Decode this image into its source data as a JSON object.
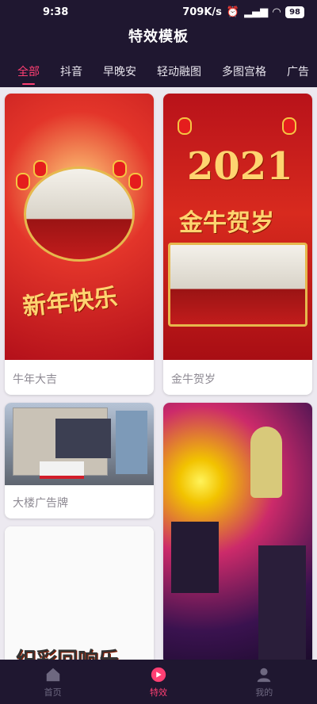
{
  "status": {
    "time": "9:38",
    "speed": "709K/s",
    "battery": "98"
  },
  "header": {
    "title": "特效模板"
  },
  "tabs": [
    {
      "label": "全部",
      "active": true
    },
    {
      "label": "抖音"
    },
    {
      "label": "早晚安"
    },
    {
      "label": "轻动融图"
    },
    {
      "label": "多图宫格"
    },
    {
      "label": "广告"
    }
  ],
  "cards": [
    {
      "label": "牛年大吉",
      "art": {
        "text": "新年快乐"
      }
    },
    {
      "label": "金牛贺岁",
      "art": {
        "year": "2021",
        "text": "金牛贺岁"
      }
    },
    {
      "label": "大楼广告牌"
    },
    {
      "label": ""
    },
    {
      "label": "",
      "art": {
        "text": "织彩回响乐"
      }
    }
  ],
  "tabbar": [
    {
      "label": "首页",
      "icon": "home-icon"
    },
    {
      "label": "特效",
      "icon": "effects-icon",
      "active": true
    },
    {
      "label": "我的",
      "icon": "profile-icon"
    }
  ],
  "colors": {
    "accent": "#ff3f73",
    "bar": "#1f1730",
    "background": "#ece9f0"
  }
}
